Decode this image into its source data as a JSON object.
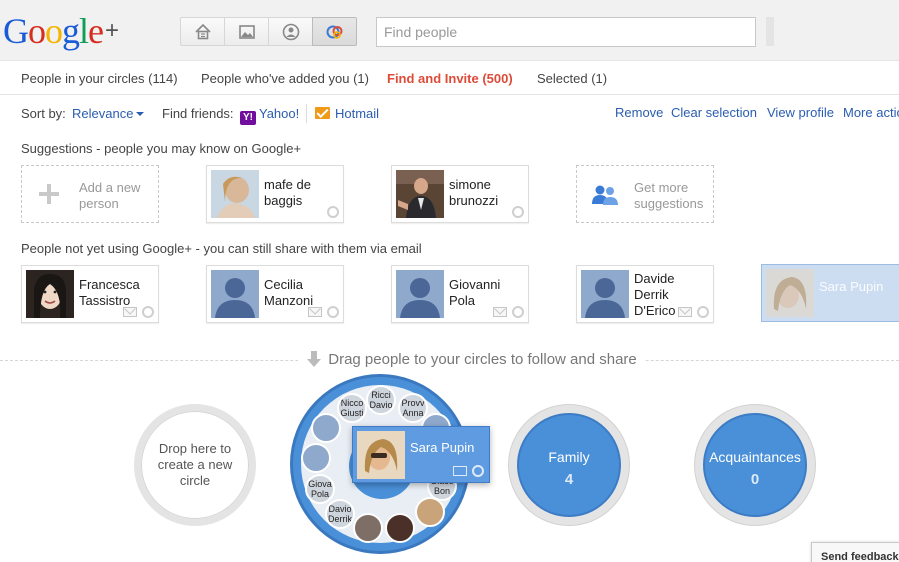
{
  "header": {
    "logo_letters": [
      "G",
      "o",
      "o",
      "g",
      "l",
      "e"
    ],
    "logo_plus": "+",
    "nav_icons": [
      "home-icon",
      "photos-icon",
      "profile-icon",
      "circles-icon"
    ],
    "search_placeholder": "Find people"
  },
  "tabs": [
    {
      "label": "People in your circles (114)",
      "active": false
    },
    {
      "label": "People who've added you (1)",
      "active": false
    },
    {
      "label": "Find and Invite (500)",
      "active": true
    },
    {
      "label": "Selected (1)",
      "active": false
    }
  ],
  "toolbar": {
    "sort_label": "Sort by:",
    "sort_value": "Relevance",
    "find_friends_label": "Find friends:",
    "yahoo_label": "Yahoo!",
    "hotmail_label": "Hotmail",
    "actions": [
      "Remove",
      "Clear selection",
      "View profile",
      "More actio"
    ]
  },
  "suggestions": {
    "heading": "Suggestions - people you may know on Google+",
    "add_new": "Add a new person",
    "people": [
      {
        "name": "mafe de baggis"
      },
      {
        "name": "simone brunozzi"
      }
    ],
    "get_more": "Get more suggestions"
  },
  "not_using": {
    "heading": "People not yet using Google+ - you can still share with them via email",
    "people": [
      {
        "name": "Francesca Tassistro"
      },
      {
        "name": "Cecilia Manzoni"
      },
      {
        "name": "Giovanni Pola"
      },
      {
        "name": "Davide Derrik D'Erico"
      },
      {
        "name": "Sara Pupin"
      }
    ]
  },
  "drag_hint": "Drag people to your circles to follow and share",
  "circles": {
    "new_circle": "Drop here to create a new circle",
    "friends_members": [
      "Ricci Davio",
      "Provv Anna",
      "Nicco Giusti",
      "Giova Pola",
      "Davio Derrik",
      "Giaco Bon"
    ],
    "family": {
      "name": "Family",
      "count": "4"
    },
    "acquaintances": {
      "name": "Acquaintances",
      "count": "0"
    }
  },
  "dragging": {
    "name": "Sara Pupin"
  },
  "feedback": "Send feedback",
  "colors": {
    "active_tab": "#dd4b39",
    "link": "#2a5db0",
    "circle_blue": "#4a90d9"
  }
}
